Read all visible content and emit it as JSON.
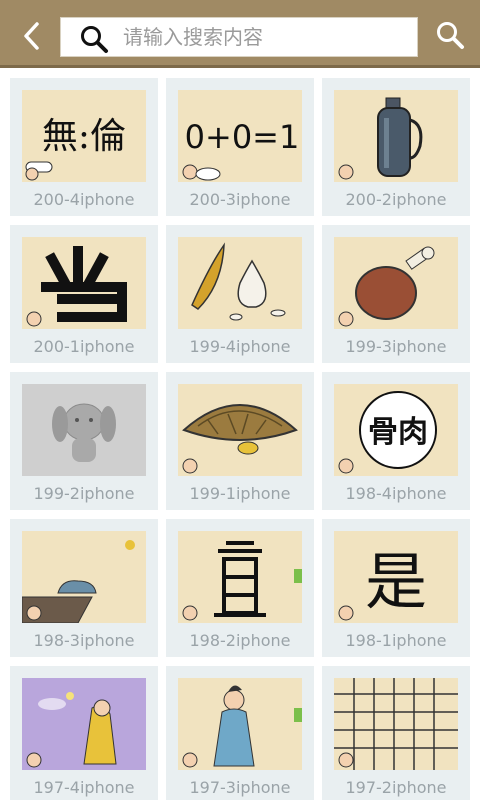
{
  "header": {
    "search_placeholder": "请输入搜索内容",
    "back_icon": "chevron-left-icon",
    "search_icon": "search-icon"
  },
  "puzzles": [
    {
      "label": "200-4iphone",
      "thumb_text": "無:倫"
    },
    {
      "label": "200-3iphone",
      "thumb_text": "0+0=1"
    },
    {
      "label": "200-2iphone"
    },
    {
      "label": "200-1iphone"
    },
    {
      "label": "199-4iphone"
    },
    {
      "label": "199-3iphone"
    },
    {
      "label": "199-2iphone"
    },
    {
      "label": "199-1iphone"
    },
    {
      "label": "198-4iphone",
      "thumb_text": "骨肉"
    },
    {
      "label": "198-3iphone"
    },
    {
      "label": "198-2iphone"
    },
    {
      "label": "198-1iphone",
      "thumb_text": "是"
    },
    {
      "label": "197-4iphone"
    },
    {
      "label": "197-3iphone"
    },
    {
      "label": "197-2iphone"
    }
  ],
  "colors": {
    "topbar": "#a08a64",
    "card": "#e9eff1",
    "thumb_paper": "#f1e3c0",
    "caption": "#9aa3a8"
  }
}
